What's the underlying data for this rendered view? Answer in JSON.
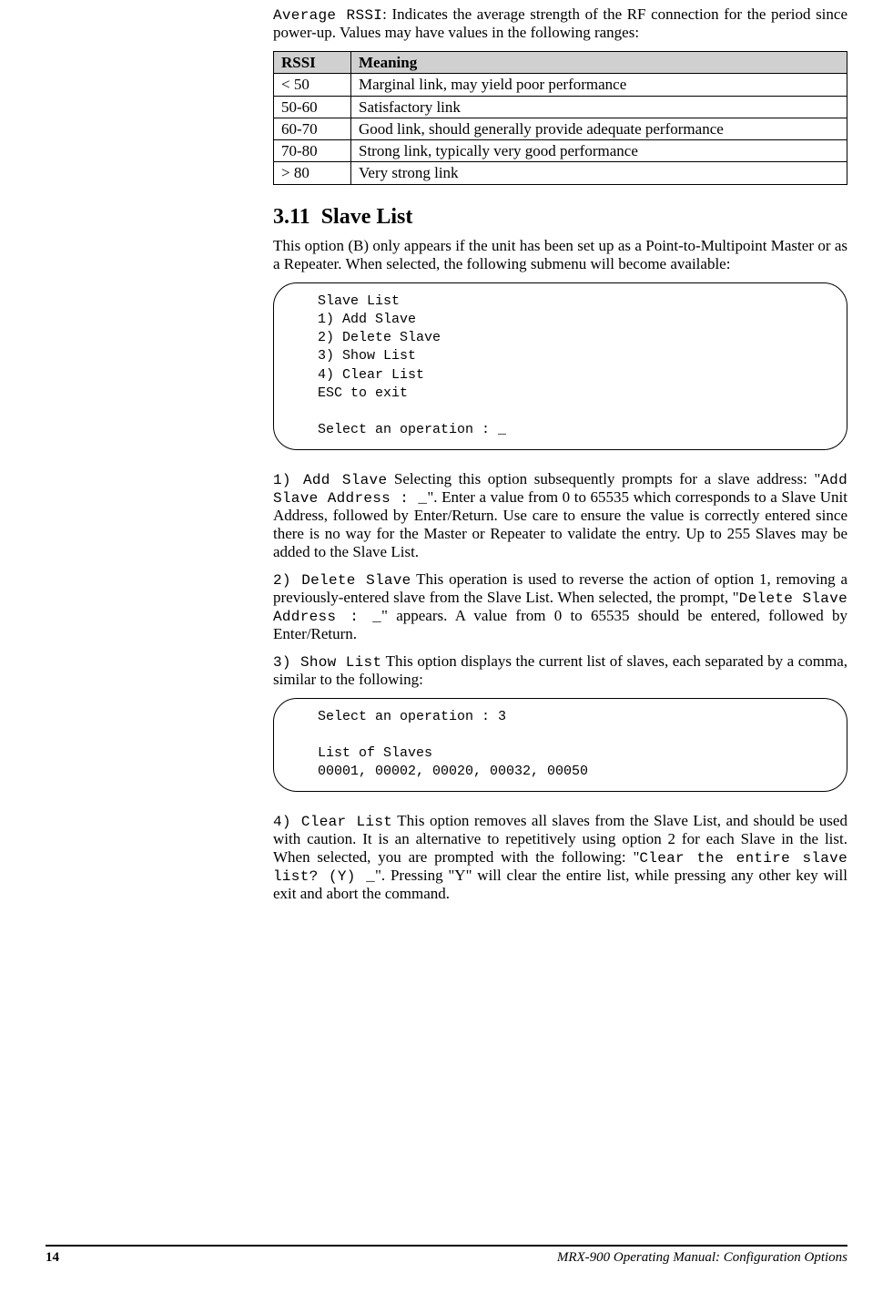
{
  "intro": {
    "label_code": "Average RSSI",
    "colon": ":  ",
    "text": "Indicates the average strength of the RF connection for the period since power-up.  Values may have values in the following ranges:"
  },
  "rssi_table": {
    "headers": [
      "RSSI",
      "Meaning"
    ],
    "rows": [
      [
        "< 50",
        "Marginal link, may yield poor performance"
      ],
      [
        "50-60",
        "Satisfactory link"
      ],
      [
        "60-70",
        "Good link, should generally provide adequate performance"
      ],
      [
        "70-80",
        "Strong link, typically very good performance"
      ],
      [
        "> 80",
        "Very strong link"
      ]
    ]
  },
  "section": {
    "number": "3.11",
    "title": "Slave List",
    "intro": "This option (B) only appears if the unit has been set up as a Point-to-Multipoint Master or as a Repeater.  When selected, the following submenu will become available:"
  },
  "codebox1": "Slave List\n1) Add Slave\n2) Delete Slave\n3) Show List\n4) Clear List\nESC to exit\n\nSelect an operation : _",
  "opt1": {
    "label": "1) Add Slave",
    "t1": "  Selecting this option subsequently prompts for a slave address: \"",
    "code1": "Add Slave Address : _",
    "t2": "\".  Enter a value from 0 to 65535 which corresponds to a Slave Unit Address, followed by Enter/Return.  Use care to ensure the value is correctly entered since there is no way for the Master or Repeater to validate the entry.  Up to 255 Slaves may be added to the Slave List."
  },
  "opt2": {
    "label": "2) Delete Slave",
    "t1": "  This operation is used to reverse the action of option 1, removing a previously-entered slave from the Slave List.  When selected, the prompt, \"",
    "code1": "Delete Slave Address : _",
    "t2": "\" appears.  A value from 0 to 65535 should be entered, followed by Enter/Return."
  },
  "opt3": {
    "label": "3) Show List",
    "t1": "  This option displays the current list of slaves, each separated by a comma, similar to the following:"
  },
  "codebox2": "Select an operation : 3\n\nList of Slaves\n00001, 00002, 00020, 00032, 00050",
  "opt4": {
    "label": "4) Clear List",
    "t1": "  This option removes all slaves from the Slave List, and should be used with caution.  It is an alternative to repetitively using option 2 for each Slave in the list.  When selected, you are prompted with the following: \"",
    "code1": "Clear the entire slave list? (Y) _",
    "t2": "\".  Pressing \"Y\" will clear the entire list, while pressing any other key will exit and abort the command."
  },
  "footer": {
    "page": "14",
    "title": "MRX-900 Operating Manual: Configuration Options"
  }
}
